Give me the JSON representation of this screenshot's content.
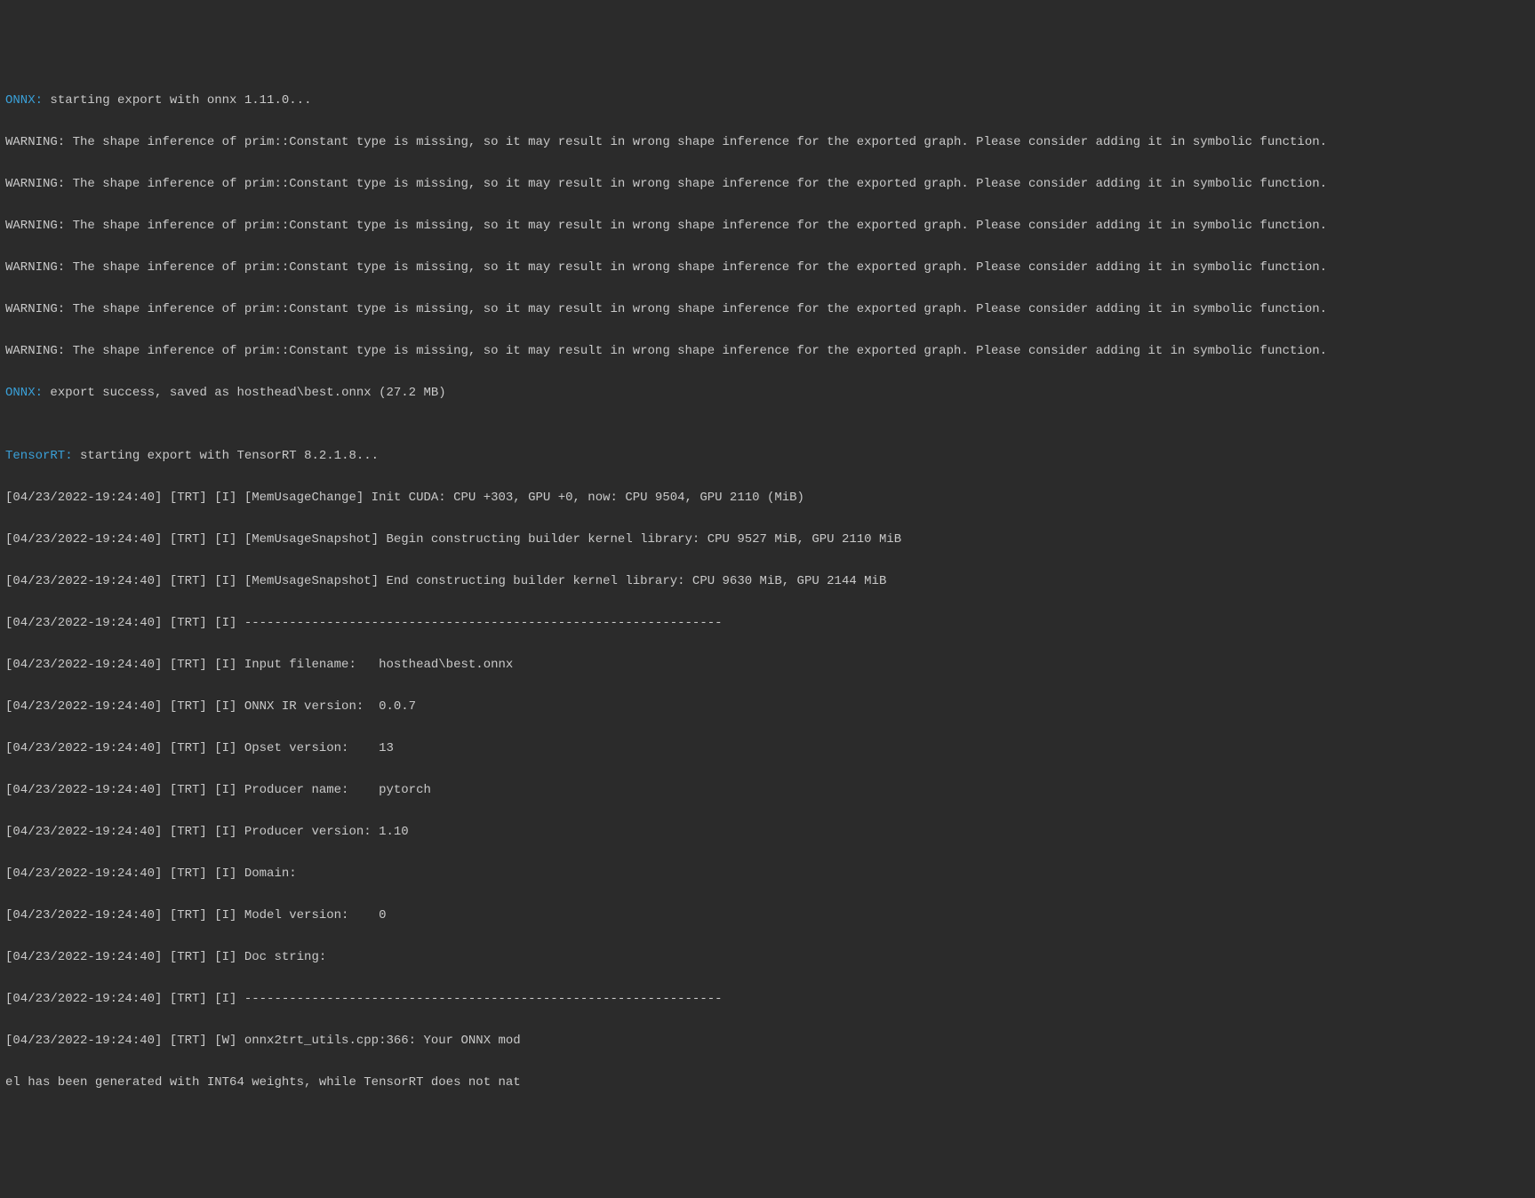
{
  "log": {
    "onnx_start_kw": "ONNX:",
    "onnx_start_rest": " starting export with onnx 1.11.0...",
    "warn": "WARNING: The shape inference of prim::Constant type is missing, so it may result in wrong shape inference for the exported graph. Please consider adding it in symbolic function.",
    "onnx_done_kw": "ONNX:",
    "onnx_done_rest": " export success, saved as hosthead\\best.onnx (27.2 MB)",
    "blank": "",
    "trt_start_kw": "TensorRT:",
    "trt_start_rest": " starting export with TensorRT 8.2.1.8...",
    "l01": "[04/23/2022-19:24:40] [TRT] [I] [MemUsageChange] Init CUDA: CPU +303, GPU +0, now: CPU 9504, GPU 2110 (MiB)",
    "l02": "[04/23/2022-19:24:40] [TRT] [I] [MemUsageSnapshot] Begin constructing builder kernel library: CPU 9527 MiB, GPU 2110 MiB",
    "l03": "[04/23/2022-19:24:40] [TRT] [I] [MemUsageSnapshot] End constructing builder kernel library: CPU 9630 MiB, GPU 2144 MiB",
    "l04": "[04/23/2022-19:24:40] [TRT] [I] ----------------------------------------------------------------",
    "l05": "[04/23/2022-19:24:40] [TRT] [I] Input filename:   hosthead\\best.onnx",
    "l06": "[04/23/2022-19:24:40] [TRT] [I] ONNX IR version:  0.0.7",
    "l07": "[04/23/2022-19:24:40] [TRT] [I] Opset version:    13",
    "l08": "[04/23/2022-19:24:40] [TRT] [I] Producer name:    pytorch",
    "l09": "[04/23/2022-19:24:40] [TRT] [I] Producer version: 1.10",
    "l10": "[04/23/2022-19:24:40] [TRT] [I] Domain:           ",
    "l11": "[04/23/2022-19:24:40] [TRT] [I] Model version:    0",
    "l12": "[04/23/2022-19:24:40] [TRT] [I] Doc string:       ",
    "l13": "[04/23/2022-19:24:40] [TRT] [I] ----------------------------------------------------------------",
    "l14": "[04/23/2022-19:24:40] [TRT] [W] onnx2trt_utils.cpp:366: Your ONNX mod",
    "l15": "el has been generated with INT64 weights, while TensorRT does not nat"
  }
}
